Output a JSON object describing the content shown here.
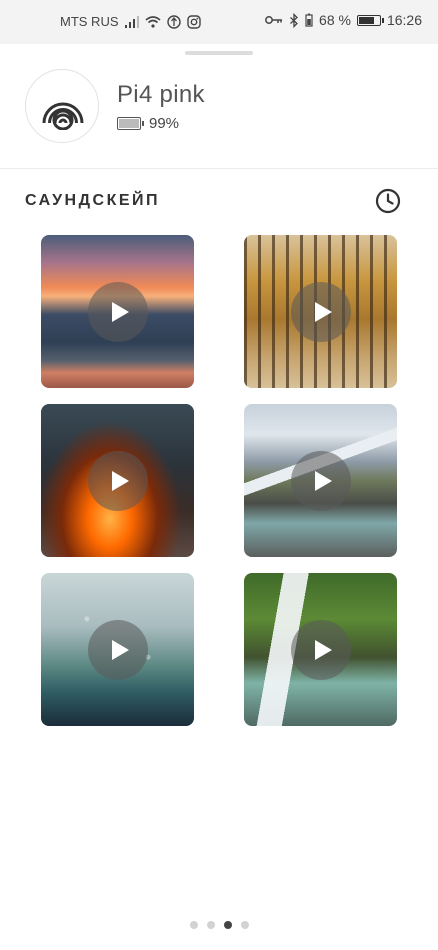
{
  "status_bar": {
    "carrier": "MTS RUS",
    "battery_percent": "68 %",
    "time": "16:26",
    "icons": [
      "signal-icon",
      "wifi-icon",
      "data-saver-icon",
      "instagram-icon",
      "key-icon",
      "bluetooth-icon",
      "battery-icon"
    ]
  },
  "device": {
    "name": "Pi4 pink",
    "battery": "99%",
    "battery_level": 0.99
  },
  "section": {
    "title": "САУНДСКЕЙП"
  },
  "soundscapes": [
    {
      "id": "sunset-sea",
      "icon": "play-icon"
    },
    {
      "id": "autumn-forest",
      "icon": "play-icon"
    },
    {
      "id": "campfire",
      "icon": "play-icon"
    },
    {
      "id": "mountain-river",
      "icon": "play-icon"
    },
    {
      "id": "rain-window",
      "icon": "play-icon"
    },
    {
      "id": "waterfall",
      "icon": "play-icon"
    }
  ],
  "pager": {
    "count": 4,
    "active_index": 2
  },
  "colors": {
    "accent": "#333333",
    "status_bar_bg": "#f3f3f3"
  }
}
